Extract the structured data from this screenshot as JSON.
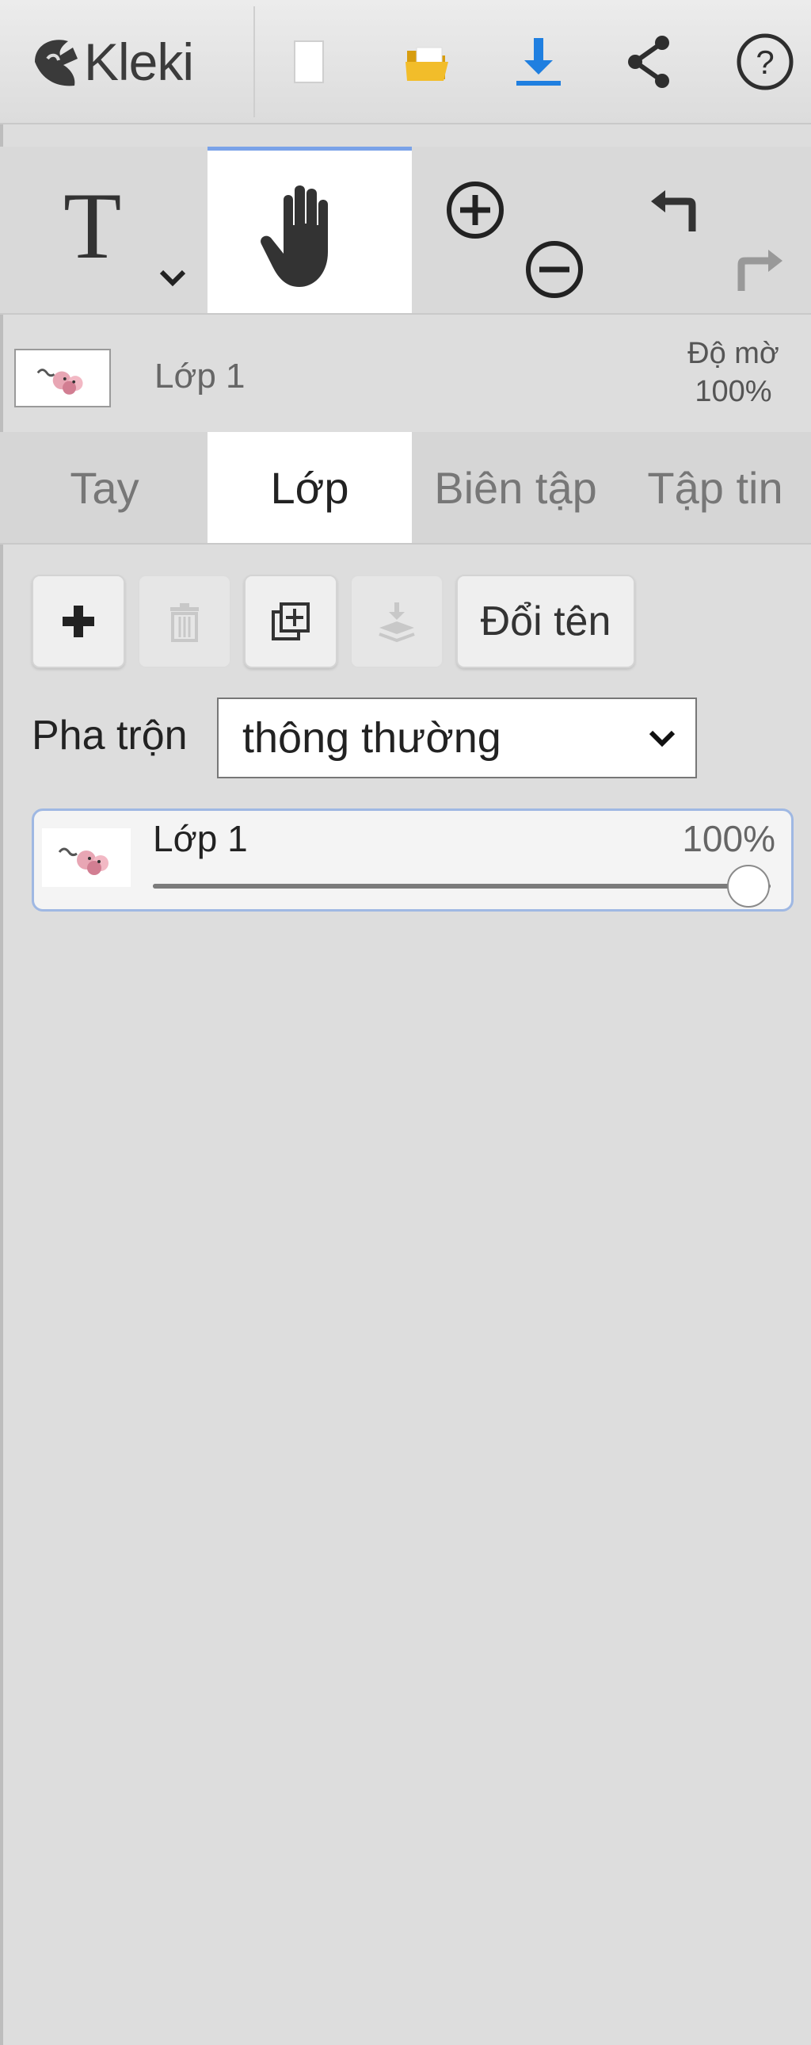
{
  "app": {
    "name": "Kleki"
  },
  "topbar": {
    "icons": [
      "new-file-icon",
      "open-folder-icon",
      "download-icon",
      "share-icon",
      "help-icon"
    ],
    "colors": {
      "folder": "#e9b21e",
      "download": "#1f7fe0"
    }
  },
  "toolbar": {
    "tools": [
      "text-tool",
      "hand-tool",
      "zoom-in",
      "zoom-out",
      "undo",
      "redo"
    ],
    "active_tool": "hand-tool",
    "text_tool_glyph": "T"
  },
  "layer_info": {
    "name": "Lớp 1",
    "opacity_label": "Độ mờ",
    "opacity_value": "100%"
  },
  "tabs": [
    {
      "label": "Tay",
      "active": false
    },
    {
      "label": "Lớp",
      "active": true
    },
    {
      "label": "Biên tập",
      "active": false
    },
    {
      "label": "Tập tin",
      "active": false
    }
  ],
  "layer_buttons": {
    "add_icon": "plus-icon",
    "delete_icon": "trash-icon",
    "duplicate_icon": "duplicate-icon",
    "merge_icon": "merge-down-icon",
    "rename_label": "Đổi tên",
    "disabled": [
      "delete",
      "merge"
    ]
  },
  "blend": {
    "label": "Pha trộn",
    "selected": "thông thường"
  },
  "layers": [
    {
      "name": "Lớp 1",
      "opacity_label": "100%",
      "opacity": 1.0
    }
  ],
  "accent": "#7aa2e8"
}
